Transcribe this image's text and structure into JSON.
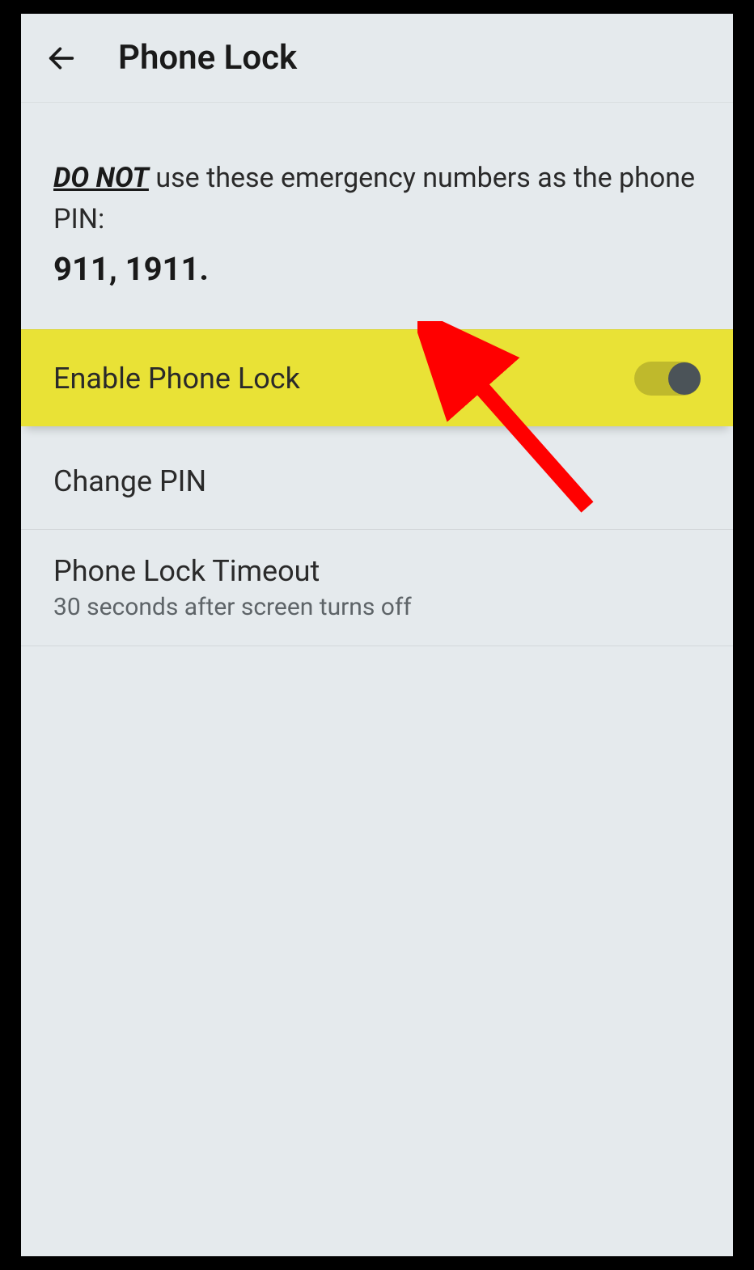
{
  "header": {
    "title": "Phone Lock"
  },
  "warning": {
    "do_not": "DO NOT",
    "text_after": " use these emergency numbers as the phone PIN:",
    "numbers": "911, 1911."
  },
  "settings": {
    "enable_lock": {
      "label": "Enable Phone Lock",
      "highlighted": true,
      "toggle_on": true
    },
    "change_pin": {
      "label": "Change PIN"
    },
    "timeout": {
      "label": "Phone Lock Timeout",
      "sub": "30 seconds after screen turns off"
    }
  },
  "colors": {
    "highlight": "#e9e236",
    "arrow": "#ff0000"
  }
}
